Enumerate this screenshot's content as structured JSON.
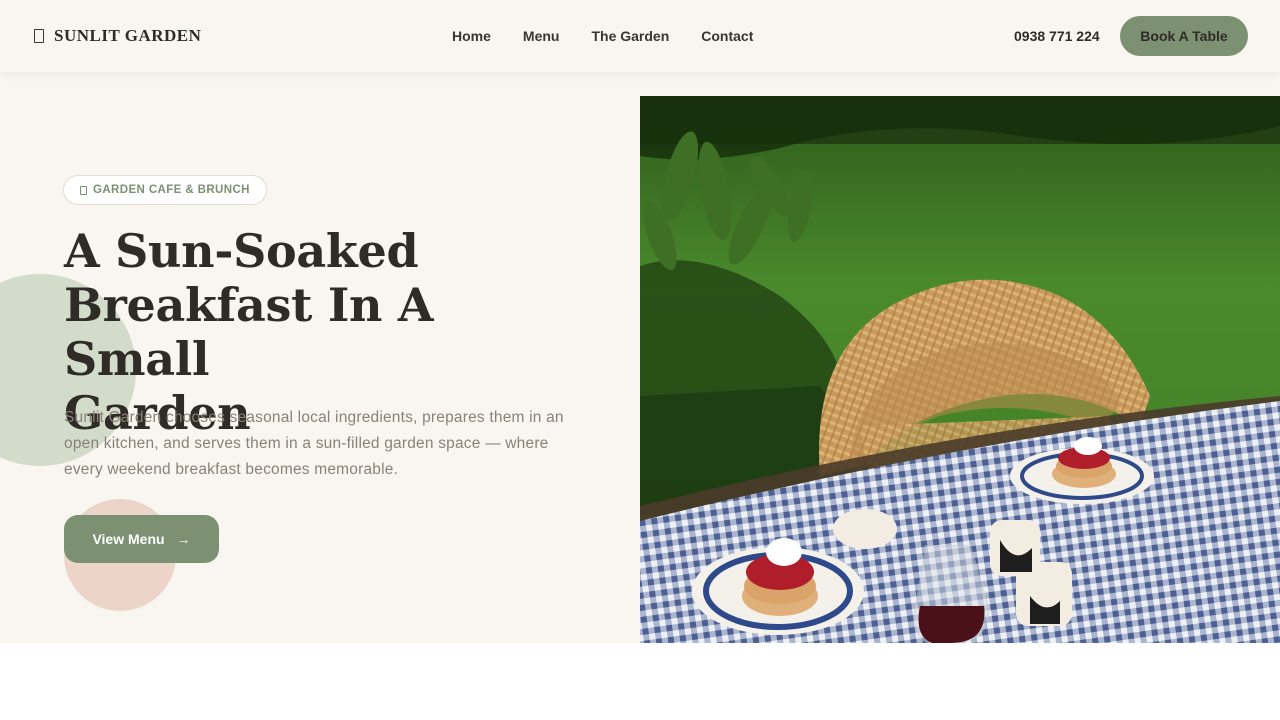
{
  "header": {
    "brand_name": "SUNLIT GARDEN",
    "nav": [
      {
        "label": "Home"
      },
      {
        "label": "Menu"
      },
      {
        "label": "The Garden"
      },
      {
        "label": "Contact"
      }
    ],
    "phone": "0938 771 224",
    "cta_label": "Book A Table"
  },
  "hero": {
    "badge_text": "GARDEN CAFE & BRUNCH",
    "title_lines": [
      "A Sun-Soaked",
      "Breakfast In A Small",
      "Garden"
    ],
    "description": "Sunlit Garden chooses seasonal local ingredients, prepares them in an open kitchen, and serves them in a sun-filled garden space — where every weekend breakfast becomes memorable.",
    "button_label": "View Menu",
    "button_icon": "arrow-right-icon"
  },
  "colors": {
    "background": "#f9f5f0",
    "accent": "#7b9172",
    "title": "#2f2b27",
    "muted": "#8a8178"
  }
}
